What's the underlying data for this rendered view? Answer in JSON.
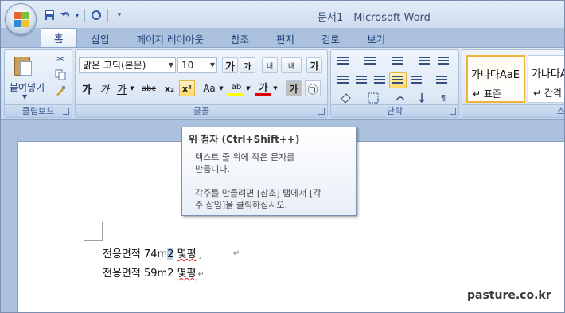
{
  "window": {
    "title": "문서1 - Microsoft Word"
  },
  "qat": {
    "save_icon": "save-icon",
    "undo_icon": "undo-icon",
    "redo_icon": "redo-icon",
    "more": "▾"
  },
  "tabs": [
    {
      "label": "홈",
      "active": true
    },
    {
      "label": "삽입"
    },
    {
      "label": "페이지 레이아웃"
    },
    {
      "label": "참조"
    },
    {
      "label": "편지"
    },
    {
      "label": "검토"
    },
    {
      "label": "보기"
    }
  ],
  "clipboard": {
    "paste_label": "붙여넣기",
    "group_label": "클립보드"
  },
  "font": {
    "font_name": "맑은 고딕(본문)",
    "font_size": "10",
    "grow": "가",
    "shrink": "가",
    "format_painter": "내",
    "bold": "가",
    "italic": "가",
    "underline": "가",
    "strike": "abc",
    "subscript": "x₂",
    "superscript": "x²",
    "change_case": "Aa",
    "highlight": "ab",
    "font_color": "가",
    "char_shade": "가",
    "enclose": "㉠",
    "group_label": "글꼴"
  },
  "paragraph": {
    "group_label": "단락"
  },
  "styles": {
    "items": [
      {
        "sample": "가나다AaE",
        "name": "↵ 표준"
      },
      {
        "sample": "가나다AaE",
        "name": "↵ 간격 없"
      }
    ],
    "group_label": "스"
  },
  "tooltip": {
    "title": "위 첨자 (Ctrl+Shift++)",
    "line1": "텍스트 줄 위에 작은 문자를",
    "line2": "만듭니다.",
    "line3": "각주를 만들려면 [참조] 탭에서 [각",
    "line4": "주 삽입]을 클릭하십시오."
  },
  "document": {
    "line1_pre": "전용면적 74m",
    "line1_sel": "2",
    "line1_post": " ",
    "line1_word": "몇평",
    "line1_mark": "¸",
    "line2_pre": "전용면적 59m2 ",
    "line2_word": "몇평",
    "para_mark": "↵"
  },
  "watermark": "pasture.co.kr"
}
